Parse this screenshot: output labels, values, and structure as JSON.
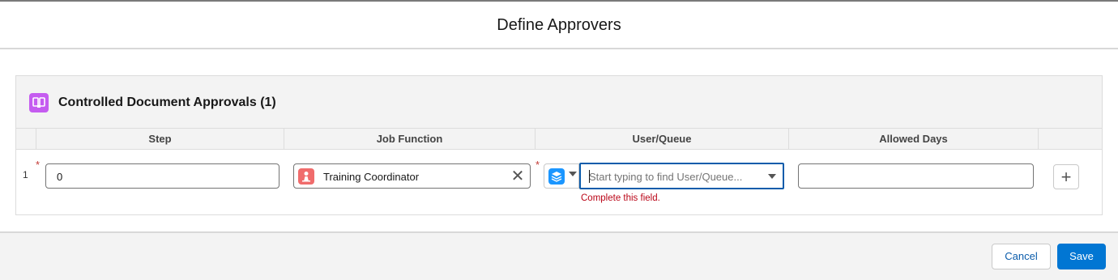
{
  "modal": {
    "title": "Define Approvers"
  },
  "card": {
    "title": "Controlled Document Approvals (1)",
    "icon": "book-icon",
    "icon_color": "#c55cf0"
  },
  "table": {
    "columns": [
      "",
      "Step",
      "Job Function",
      "User/Queue",
      "Allowed Days",
      ""
    ],
    "rows": [
      {
        "number": "1",
        "step_value": "0",
        "job_function_value": "Training Coordinator",
        "user_queue_placeholder": "Start typing to find User/Queue...",
        "user_queue_error": "Complete this field.",
        "allowed_days_value": ""
      }
    ],
    "required_marker": "*"
  },
  "footer": {
    "cancel_label": "Cancel",
    "save_label": "Save"
  },
  "colors": {
    "brand": "#0176d3",
    "error": "#ba0517",
    "focus_border": "#0b5cab"
  }
}
